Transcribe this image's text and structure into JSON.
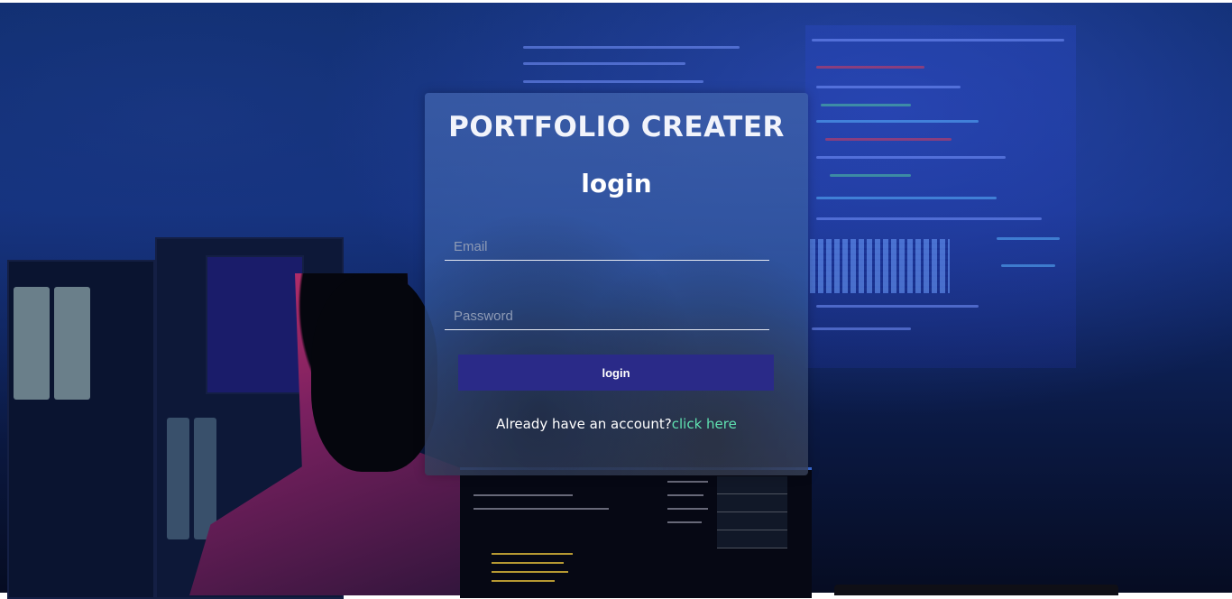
{
  "app": {
    "title": "PORTFOLIO CREATER",
    "subtitle": "login"
  },
  "form": {
    "email_placeholder": "Email",
    "email_value": "",
    "password_placeholder": "Password",
    "password_value": "",
    "submit_label": "login"
  },
  "footer": {
    "prompt": "Already have an account?",
    "link_label": "click here"
  },
  "colors": {
    "button_bg": "#2a2a88",
    "link": "#5fe0b0",
    "card_tint": "#3e60aa"
  },
  "icons": {
    "background": "developer-workspace-photo"
  }
}
